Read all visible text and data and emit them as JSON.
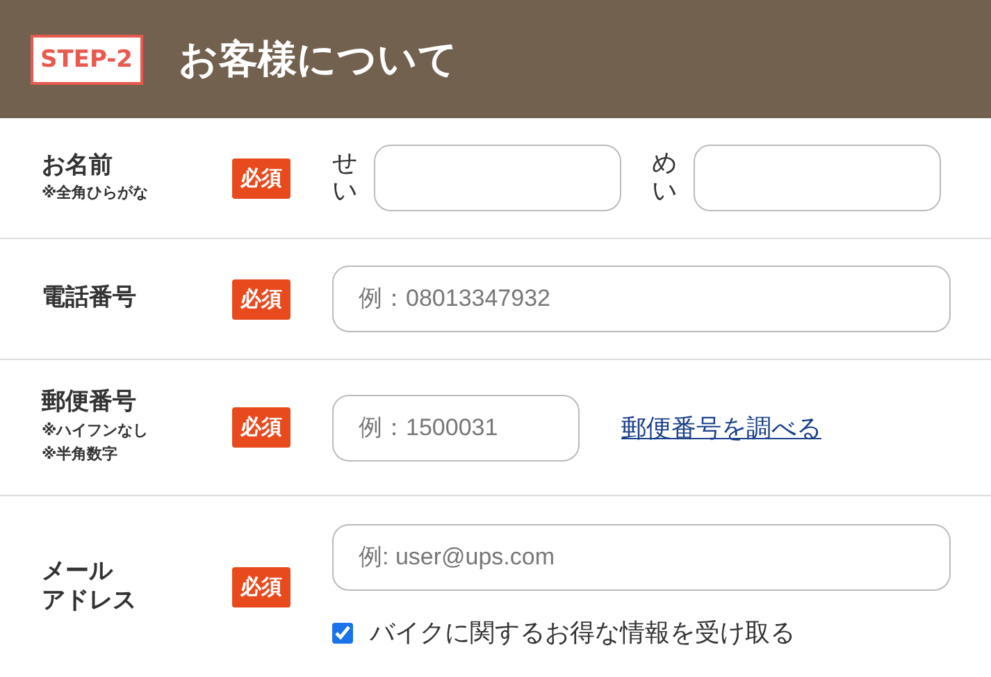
{
  "header": {
    "step": "STEP-2",
    "title": "お客様について"
  },
  "rows": [
    {
      "kind": "name",
      "label": "お名前",
      "notes": [
        "※全角ひらがな"
      ],
      "required": "必須",
      "fields": [
        {
          "label": "せい"
        },
        {
          "label": "めい"
        }
      ]
    },
    {
      "kind": "text",
      "label": "電話番号",
      "notes": [],
      "required": "必須",
      "placeholder": "例：08013347932"
    },
    {
      "kind": "postal",
      "label": "郵便番号",
      "notes": [
        "※ハイフンなし",
        "※半角数字"
      ],
      "required": "必須",
      "placeholder": "例：1500031",
      "link": "郵便番号を調べる"
    },
    {
      "kind": "email",
      "label": "メール",
      "label_line2": "アドレス",
      "notes": [],
      "required": "必須",
      "placeholder": "例: user@ups.com",
      "checkbox": {
        "label": "バイクに関するお得な情報を受け取る",
        "checked": true
      }
    }
  ]
}
